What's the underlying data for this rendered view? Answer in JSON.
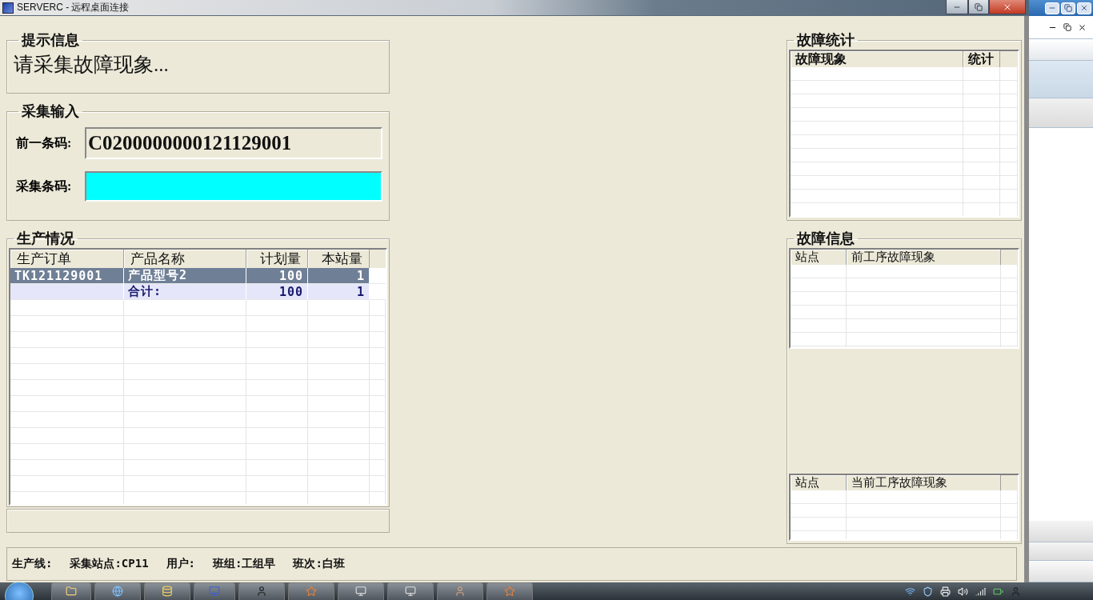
{
  "window": {
    "title": "SERVERC - 远程桌面连接"
  },
  "prompt": {
    "title": "提示信息",
    "message": "请采集故障现象..."
  },
  "input": {
    "title": "采集输入",
    "previous_label": "前一条码:",
    "previous_value": "C0200000000121129001",
    "scan_label": "采集条码:"
  },
  "production": {
    "title": "生产情况",
    "columns": [
      "生产订单",
      "产品名称",
      "计划量",
      "本站量"
    ],
    "rows": [
      {
        "kind": "order",
        "selected": true,
        "cells": [
          "TK121129001",
          "产品型号2",
          "100",
          "1"
        ]
      },
      {
        "kind": "total",
        "selected": false,
        "cells": [
          "",
          "合计:",
          "100",
          "1"
        ]
      }
    ]
  },
  "fault_stats": {
    "title": "故障统计",
    "columns": [
      "故障现象",
      "统计"
    ]
  },
  "fault_info": {
    "title": "故障信息",
    "previous_columns": [
      "站点",
      "前工序故障现象"
    ],
    "current_columns": [
      "站点",
      "当前工序故障现象"
    ]
  },
  "status_bar": [
    "生产线:",
    "采集站点:CP11",
    "用户:",
    "班组:工组早",
    "班次:白班"
  ]
}
